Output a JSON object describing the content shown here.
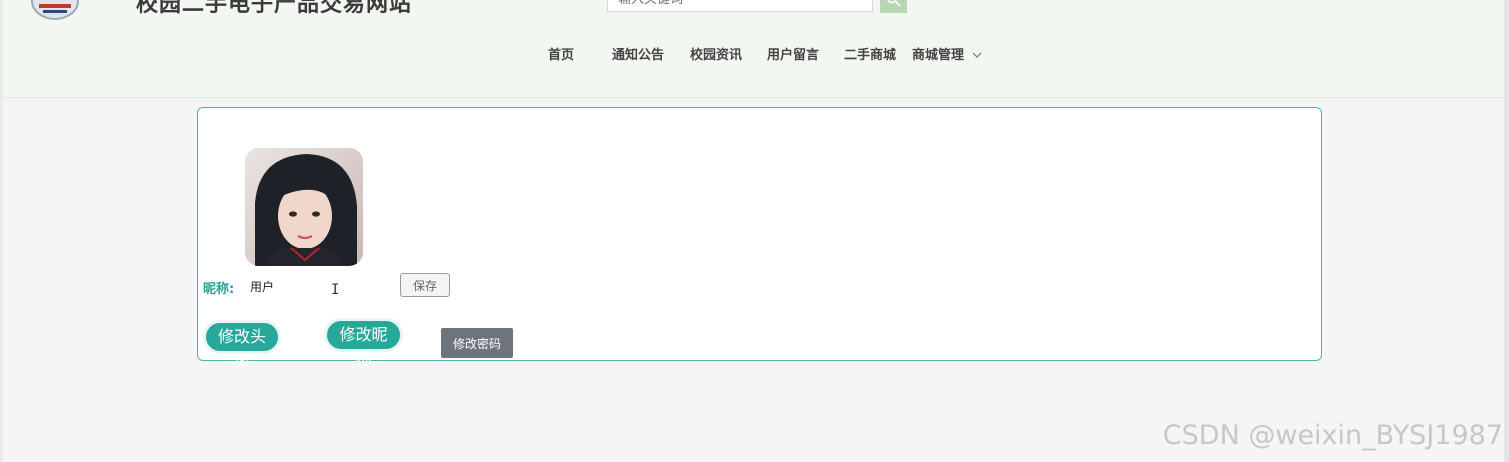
{
  "header": {
    "site_title": "校园二手电子产品交易网站",
    "search_placeholder": "输入关键词"
  },
  "nav": {
    "items": [
      "首页",
      "通知公告",
      "校园资讯",
      "用户留言",
      "二手商城",
      "商城管理"
    ]
  },
  "profile": {
    "nickname_label": "昵称:",
    "nickname_value": "用户",
    "save_label": "保存",
    "change_avatar_label": "修改头像",
    "change_nickname_label": "修改昵称",
    "change_password_label": "修改密码"
  },
  "watermark": "CSDN @weixin_BYSJ1987",
  "colors": {
    "accent": "#26a99a",
    "header_bg": "#f3f7f1",
    "card_border": "#4fb3a8"
  }
}
